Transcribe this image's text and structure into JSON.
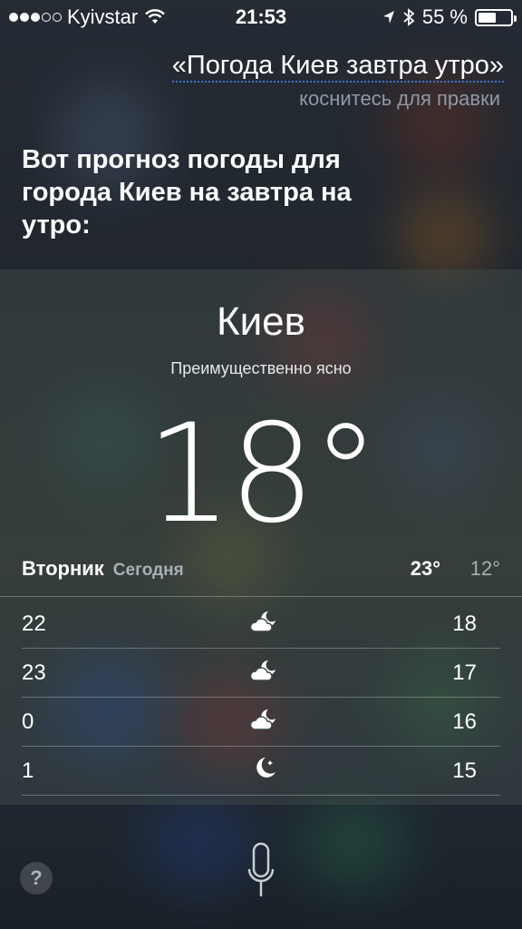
{
  "status_bar": {
    "carrier": "Kyivstar",
    "time": "21:53",
    "battery": "55 %",
    "battery_level": 0.55,
    "signal_bars_filled": 3,
    "signal_bars_total": 5
  },
  "siri": {
    "query": "«Погода Киев завтра утро»",
    "tap_to_edit": "коснитесь для правки",
    "response": "Вот прогноз погоды для города Киев на завтра на утро:"
  },
  "weather": {
    "city": "Киев",
    "condition": "Преимущественно ясно",
    "temperature": "18°",
    "day": "Вторник",
    "today_label": "Сегодня",
    "high": "23°",
    "low": "12°",
    "hourly": [
      {
        "hour": "22",
        "icon": "partly-cloudy-night-icon",
        "temp": "18"
      },
      {
        "hour": "23",
        "icon": "partly-cloudy-night-icon",
        "temp": "17"
      },
      {
        "hour": "0",
        "icon": "partly-cloudy-night-icon",
        "temp": "16"
      },
      {
        "hour": "1",
        "icon": "clear-night-icon",
        "temp": "15"
      }
    ]
  },
  "controls": {
    "help_label": "?",
    "mic_icon": "microphone-icon"
  }
}
